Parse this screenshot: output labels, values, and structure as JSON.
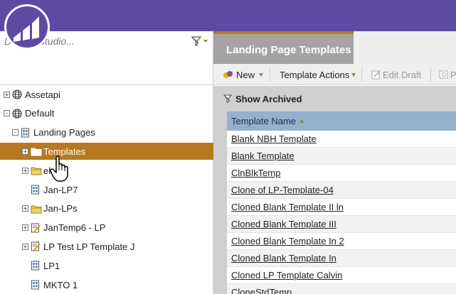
{
  "search": {
    "placeholder": "Design Studio..."
  },
  "tree": [
    {
      "label": "Assetapi",
      "icon": "globe-icon",
      "expander": "+",
      "level": 0
    },
    {
      "label": "Default",
      "icon": "globe-icon",
      "expander": "-",
      "level": 0
    },
    {
      "label": "Landing Pages",
      "icon": "page-grid-icon",
      "expander": "-",
      "level": 1
    },
    {
      "label": "Templates",
      "icon": "folder-white-icon",
      "expander": "+",
      "level": 2,
      "selected": true
    },
    {
      "label": "el",
      "icon": "folder-icon",
      "expander": "+",
      "level": 2
    },
    {
      "label": "Jan-LP7",
      "icon": "page-grid-icon",
      "expander": "",
      "level": 2
    },
    {
      "label": "Jan-LPs",
      "icon": "folder-icon",
      "expander": "+",
      "level": 2
    },
    {
      "label": "JanTemp6 - LP",
      "icon": "page-edit-icon",
      "expander": "+",
      "level": 2
    },
    {
      "label": "LP Test LP Template J",
      "icon": "page-edit-icon",
      "expander": "+",
      "level": 2
    },
    {
      "label": "LP1",
      "icon": "page-grid-icon",
      "expander": "",
      "level": 2
    },
    {
      "label": "MKTO 1",
      "icon": "page-grid-icon",
      "expander": "",
      "level": 2
    }
  ],
  "tab": {
    "label": "Landing Page Templates"
  },
  "toolbar": {
    "new_label": "New",
    "actions_label": "Template Actions",
    "edit_label": "Edit Draft",
    "preview_label": "P"
  },
  "show_archived": "Show Archived",
  "grid": {
    "column": "Template Name",
    "rows": [
      "Blank NBH Template",
      "Blank Template",
      "ClnBlkTemp",
      "Clone of LP-Template-04",
      "Cloned Blank Template II ln",
      "Cloned Blank Template III",
      "Cloned Blank Template In 2",
      "Cloned Blank Template In",
      "Cloned LP Template Calvin",
      "CloneStdTemp"
    ]
  },
  "colors": {
    "brand": "#5e4aa3",
    "selected": "#b8791e",
    "grid_header": "#95b0cc"
  }
}
